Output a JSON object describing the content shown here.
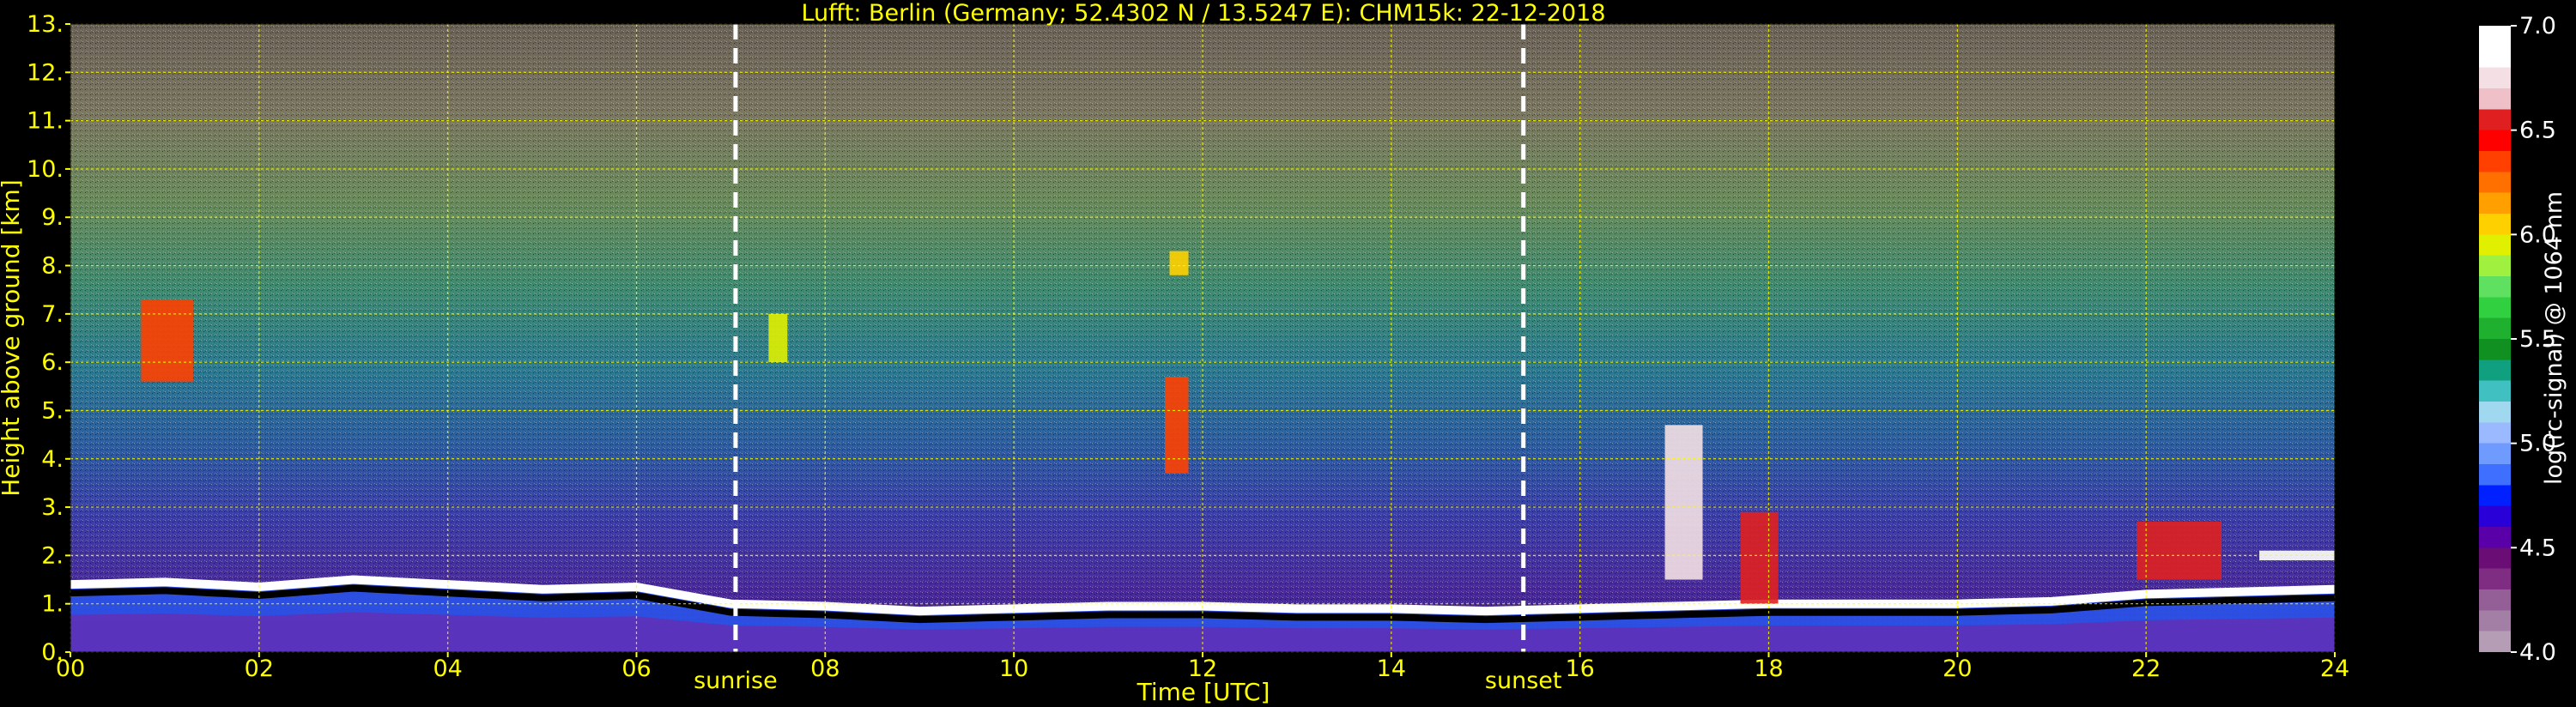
{
  "chart_data": {
    "type": "heatmap",
    "title": "Lufft: Berlin (Germany; 52.4302 N / 13.5247 E):    CHM15k: 22-12-2018",
    "xlabel": "Time [UTC]",
    "ylabel": "Height above ground [km]",
    "xlim": [
      0,
      24
    ],
    "ylim": [
      0,
      13
    ],
    "x_ticks": [
      "00",
      "02",
      "04",
      "06",
      "08",
      "10",
      "12",
      "14",
      "16",
      "18",
      "20",
      "22",
      "24"
    ],
    "y_ticks": [
      "0.",
      "1.",
      "2.",
      "3.",
      "4.",
      "5.",
      "6.",
      "7.",
      "8.",
      "9.",
      "10.",
      "11.",
      "12.",
      "13."
    ],
    "grid": true,
    "markers": [
      {
        "label": "sunrise",
        "time": 7.05
      },
      {
        "label": "sunset",
        "time": 15.4
      }
    ],
    "colorbar": {
      "label": "log(rc-signal) @ 1064 nm",
      "range": [
        4.0,
        7.0
      ],
      "ticks": [
        "4.0",
        "4.5",
        "5.0",
        "5.5",
        "6.0",
        "6.5",
        "7.0"
      ],
      "colors": [
        "#b49db5",
        "#a37fa6",
        "#935f96",
        "#7e2d83",
        "#6a0d75",
        "#5a00a8",
        "#2a00d8",
        "#0020ff",
        "#3f6fff",
        "#6f9bff",
        "#9bb9ff",
        "#a0d9ef",
        "#40c0c0",
        "#10a080",
        "#109020",
        "#20b030",
        "#30d040",
        "#60e060",
        "#a0f040",
        "#e0f000",
        "#ffd000",
        "#ffa000",
        "#ff7000",
        "#ff4000",
        "#ff0000",
        "#e02020",
        "#f0c0c8",
        "#f4e0e4",
        "#ffffff",
        "#ffffff"
      ]
    },
    "boundary_layer_height_km": [
      {
        "t": 0,
        "h": 1.4
      },
      {
        "t": 1,
        "h": 1.45
      },
      {
        "t": 2,
        "h": 1.35
      },
      {
        "t": 3,
        "h": 1.5
      },
      {
        "t": 4,
        "h": 1.4
      },
      {
        "t": 5,
        "h": 1.3
      },
      {
        "t": 6,
        "h": 1.35
      },
      {
        "t": 7,
        "h": 1.0
      },
      {
        "t": 8,
        "h": 0.95
      },
      {
        "t": 9,
        "h": 0.85
      },
      {
        "t": 10,
        "h": 0.9
      },
      {
        "t": 11,
        "h": 0.95
      },
      {
        "t": 12,
        "h": 0.95
      },
      {
        "t": 13,
        "h": 0.9
      },
      {
        "t": 14,
        "h": 0.9
      },
      {
        "t": 15,
        "h": 0.85
      },
      {
        "t": 16,
        "h": 0.9
      },
      {
        "t": 17,
        "h": 0.95
      },
      {
        "t": 18,
        "h": 1.0
      },
      {
        "t": 19,
        "h": 1.0
      },
      {
        "t": 20,
        "h": 1.0
      },
      {
        "t": 21,
        "h": 1.05
      },
      {
        "t": 22,
        "h": 1.2
      },
      {
        "t": 23,
        "h": 1.25
      },
      {
        "t": 24,
        "h": 1.3
      }
    ],
    "cloud_features": [
      {
        "t_start": 0.75,
        "t_end": 1.3,
        "h_base": 5.6,
        "h_top": 7.3,
        "level": 6.3
      },
      {
        "t_start": 11.6,
        "t_end": 11.85,
        "h_base": 3.7,
        "h_top": 5.7,
        "level": 6.3
      },
      {
        "t_start": 11.65,
        "t_end": 11.85,
        "h_base": 7.8,
        "h_top": 8.3,
        "level": 6.0
      },
      {
        "t_start": 7.4,
        "t_end": 7.6,
        "h_base": 6.0,
        "h_top": 7.0,
        "level": 5.9
      },
      {
        "t_start": 16.9,
        "t_end": 17.3,
        "h_base": 1.5,
        "h_top": 4.7,
        "level": 6.8
      },
      {
        "t_start": 17.7,
        "t_end": 18.1,
        "h_base": 1.0,
        "h_top": 2.9,
        "level": 6.6
      },
      {
        "t_start": 21.9,
        "t_end": 22.8,
        "h_base": 1.5,
        "h_top": 2.7,
        "level": 6.6
      },
      {
        "t_start": 23.2,
        "t_end": 24,
        "h_base": 1.9,
        "h_top": 2.1,
        "level": 7.0
      }
    ]
  }
}
